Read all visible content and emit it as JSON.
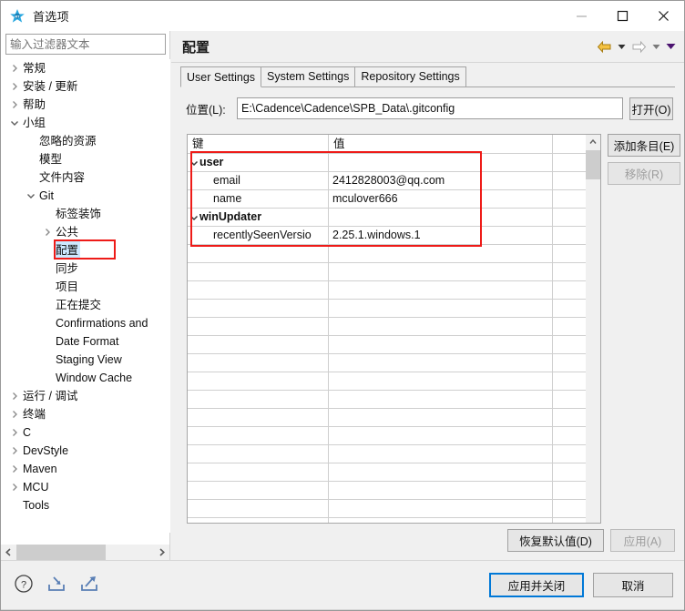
{
  "window": {
    "title": "首选项",
    "app_icon": "eclipse-star-icon",
    "controls": {
      "minimize": "minimize-icon",
      "maximize": "maximize-icon",
      "close": "close-icon"
    }
  },
  "sidebar": {
    "filter": {
      "value": "",
      "placeholder": "输入过滤器文本"
    },
    "items": [
      {
        "label": "常规",
        "indent": 0,
        "twisty": "collapsed"
      },
      {
        "label": "安装 / 更新",
        "indent": 0,
        "twisty": "collapsed"
      },
      {
        "label": "帮助",
        "indent": 0,
        "twisty": "collapsed"
      },
      {
        "label": "小组",
        "indent": 0,
        "twisty": "expanded"
      },
      {
        "label": "忽略的资源",
        "indent": 1,
        "twisty": "none"
      },
      {
        "label": "模型",
        "indent": 1,
        "twisty": "none"
      },
      {
        "label": "文件内容",
        "indent": 1,
        "twisty": "none"
      },
      {
        "label": "Git",
        "indent": 1,
        "twisty": "expanded"
      },
      {
        "label": "标签装饰",
        "indent": 2,
        "twisty": "none"
      },
      {
        "label": "公共",
        "indent": 2,
        "twisty": "collapsed"
      },
      {
        "label": "配置",
        "indent": 2,
        "twisty": "none",
        "selected": true,
        "annotated": true
      },
      {
        "label": "同步",
        "indent": 2,
        "twisty": "none"
      },
      {
        "label": "项目",
        "indent": 2,
        "twisty": "none"
      },
      {
        "label": "正在提交",
        "indent": 2,
        "twisty": "none"
      },
      {
        "label": "Confirmations and ",
        "indent": 2,
        "twisty": "none"
      },
      {
        "label": "Date Format",
        "indent": 2,
        "twisty": "none"
      },
      {
        "label": "Staging View",
        "indent": 2,
        "twisty": "none"
      },
      {
        "label": "Window Cache",
        "indent": 2,
        "twisty": "none"
      },
      {
        "label": "运行 / 调试",
        "indent": 0,
        "twisty": "collapsed"
      },
      {
        "label": "终端",
        "indent": 0,
        "twisty": "collapsed"
      },
      {
        "label": "C",
        "indent": 0,
        "twisty": "collapsed"
      },
      {
        "label": "DevStyle",
        "indent": 0,
        "twisty": "collapsed"
      },
      {
        "label": "Maven",
        "indent": 0,
        "twisty": "collapsed"
      },
      {
        "label": "MCU",
        "indent": 0,
        "twisty": "collapsed"
      },
      {
        "label": "Tools",
        "indent": 0,
        "twisty": "none"
      }
    ],
    "hscroll": {
      "left_arrow": "chevron-left-icon",
      "right_arrow": "chevron-right-icon"
    }
  },
  "page": {
    "title": "配置",
    "nav": {
      "back": "back-arrow-icon",
      "back_dropdown": "chevron-down-icon",
      "forward": "forward-arrow-icon",
      "forward_dropdown": "chevron-down-icon",
      "menu_dropdown": "chevron-down-icon"
    },
    "tabs": [
      {
        "label": "User Settings",
        "active": true
      },
      {
        "label": "System Settings",
        "active": false
      },
      {
        "label": "Repository Settings",
        "active": false
      }
    ],
    "location": {
      "label": "位置(L):",
      "value": "E:\\Cadence\\Cadence\\SPB_Data\\.gitconfig",
      "placeholder": "",
      "open_button": "打开(O)"
    },
    "table": {
      "columns": [
        "键",
        "值",
        ""
      ],
      "rows": [
        {
          "key": "user",
          "value": "",
          "group": true,
          "twisty": "expanded"
        },
        {
          "key": "email",
          "value": "2412828003@qq.com",
          "group": false
        },
        {
          "key": "name",
          "value": "mculover666",
          "group": false
        },
        {
          "key": "winUpdater",
          "value": "",
          "group": true,
          "twisty": "expanded"
        },
        {
          "key": "recentlySeenVersio",
          "value": "2.25.1.windows.1",
          "group": false
        }
      ],
      "empty_row_count": 16,
      "scrollbar": {
        "up": "chevron-up-icon",
        "down": "chevron-down-icon"
      }
    },
    "side_buttons": [
      {
        "label": "添加条目(E)",
        "disabled": false
      },
      {
        "label": "移除(R)",
        "disabled": true
      }
    ],
    "bottom_buttons": [
      {
        "label": "恢复默认值(D)",
        "disabled": false
      },
      {
        "label": "应用(A)",
        "disabled": true
      }
    ]
  },
  "footer": {
    "icons": [
      {
        "name": "help-icon"
      },
      {
        "name": "import-icon"
      },
      {
        "name": "export-icon"
      }
    ],
    "ok_button": "应用并关闭",
    "cancel_button": "取消"
  },
  "colors": {
    "accent": "#0078d7",
    "annotation": "#ee1b18",
    "selection": "#cde8ff",
    "chrome": "#f0f0f0"
  }
}
